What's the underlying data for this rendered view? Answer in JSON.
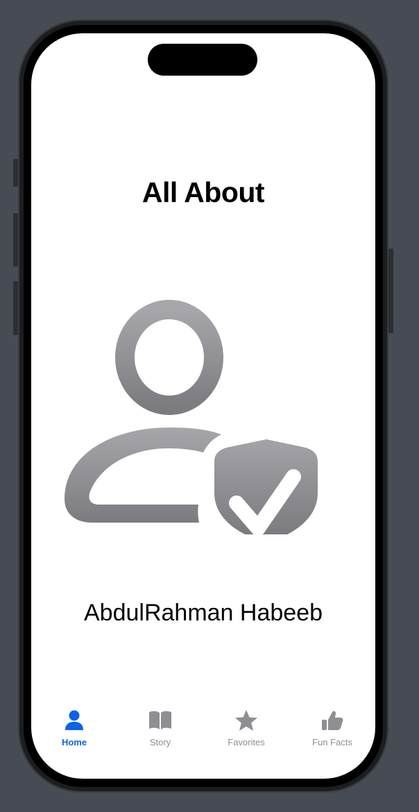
{
  "screen": {
    "title": "All About",
    "name": "AbdulRahman Habeeb",
    "hero_icon": "person-badge-shield-checkmark-icon"
  },
  "tabbar": {
    "active_color": "#0a64e6",
    "inactive_color": "#8e8e93",
    "tabs": [
      {
        "label": "Home",
        "icon": "person-icon",
        "active": true
      },
      {
        "label": "Story",
        "icon": "book-icon",
        "active": false
      },
      {
        "label": "Favorites",
        "icon": "star-icon",
        "active": false
      },
      {
        "label": "Fun Facts",
        "icon": "thumbs-up-icon",
        "active": false
      }
    ]
  }
}
